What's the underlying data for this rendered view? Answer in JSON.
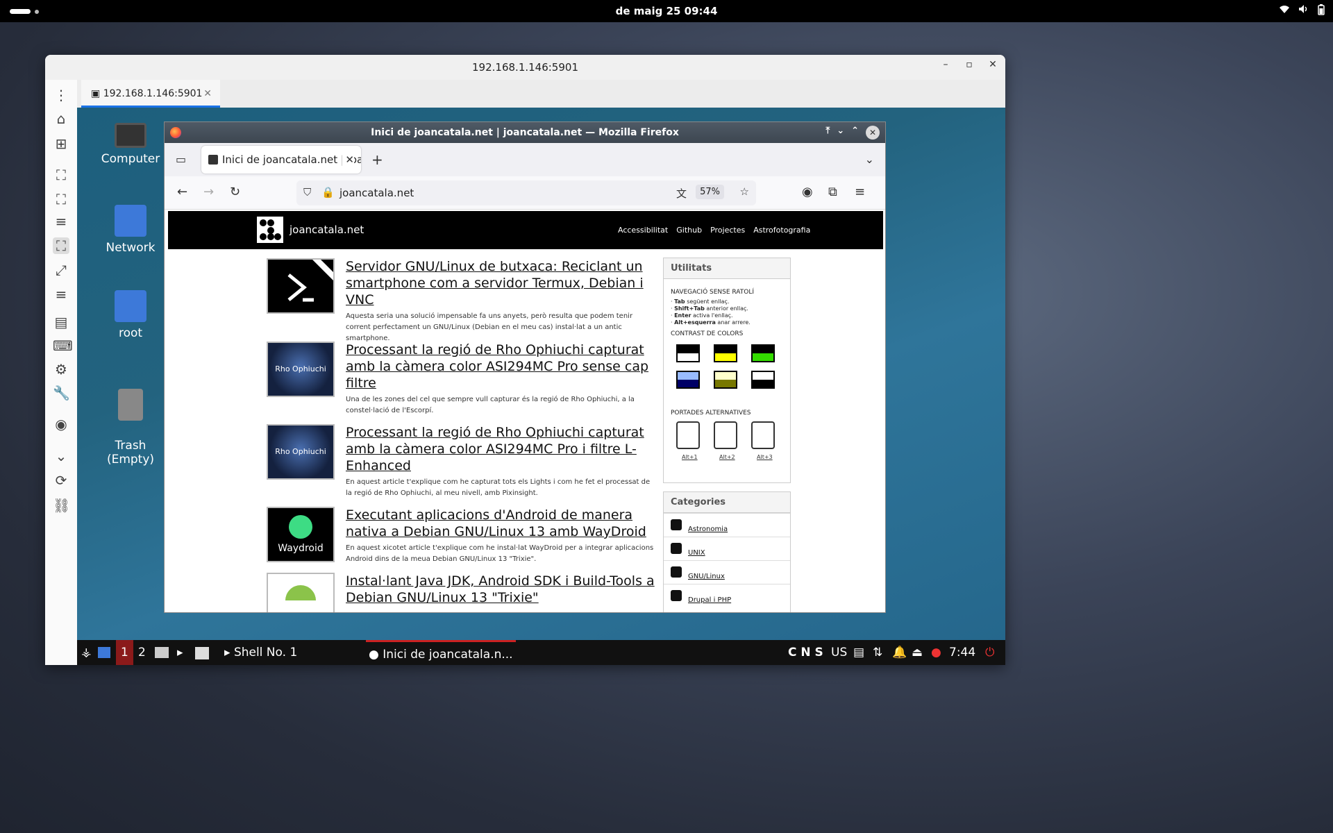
{
  "topbar": {
    "clock": "de maig 25  09:44",
    "tray_icons": [
      "wifi-icon",
      "volume-icon",
      "battery-icon"
    ]
  },
  "viewer": {
    "title": "192.168.1.146:5901",
    "tab_label": "192.168.1.146:5901",
    "controls": [
      "minimize",
      "maximize",
      "close"
    ]
  },
  "desktop": {
    "icons": [
      {
        "label": "Computer"
      },
      {
        "label": "Network"
      },
      {
        "label": "root"
      },
      {
        "label": "Trash\n(Empty)"
      }
    ]
  },
  "firefox": {
    "title": "Inici de joancatala.net | joancatala.net — Mozilla Firefox",
    "tab_label": "Inici de joancatala.net | joancatala.net",
    "url": "joancatala.net",
    "zoom": "57%"
  },
  "site": {
    "name": "joancatala.net",
    "nav": [
      "Accessibilitat",
      "Github",
      "Projectes",
      "Astrofotografia"
    ],
    "posts": [
      {
        "title": "Servidor GNU/Linux de butxaca: Reciclant un smartphone com a servidor Termux, Debian i VNC",
        "desc": "Aquesta seria una solució impensable fa uns anyets, però resulta que podem tenir corrent perfectament un GNU/Linux (Debian en el meu cas) instal·lat a un antic smartphone.",
        "thumb_label": ""
      },
      {
        "title": "Processant la regió de Rho Ophiuchi capturat amb la càmera color ASI294MC Pro sense cap filtre",
        "desc": "Una de les zones del cel que sempre vull capturar és la regió de Rho Ophiuchi, a la constel·lació de l'Escorpí.",
        "thumb_label": "Rho Ophiuchi"
      },
      {
        "title": "Processant la regió de Rho Ophiuchi capturat amb la càmera color ASI294MC Pro i filtre L-Enhanced",
        "desc": "En aquest article t'explique com he capturat tots els Lights i com he fet el processat de la regió de Rho Ophiuchi, al meu nivell, amb Pixinsight.",
        "thumb_label": "Rho Ophiuchi"
      },
      {
        "title": "Executant aplicacions d'Android de manera nativa a Debian GNU/Linux 13 amb WayDroid",
        "desc": "En aquest xicotet article t'explique com he instal·lat WayDroid per a integrar aplicacions Android dins de la meua Debian GNU/Linux 13 \"Trixie\".",
        "thumb_label": "Waydroid"
      },
      {
        "title": "Instal·lant Java JDK, Android SDK i Build-Tools a Debian GNU/Linux 13 \"Trixie\"",
        "desc": "",
        "thumb_label": ""
      }
    ],
    "utilitats": {
      "head": "Utilitats",
      "nav_head": "NAVEGACIÓ SENSE RATOLÍ",
      "nav_lines": [
        {
          "key": "Tab",
          "text": " següent enllaç."
        },
        {
          "key": "Shift+Tab",
          "text": " anterior enllaç."
        },
        {
          "key": "Enter",
          "text": " activa l'enllaç."
        },
        {
          "key": "Alt+esquerra",
          "text": " anar arrere."
        }
      ],
      "contrast_head": "CONTRAST DE COLORS",
      "swatches": [
        {
          "top": "#000000",
          "bottom": "#ffffff"
        },
        {
          "top": "#000000",
          "bottom": "#ffff00"
        },
        {
          "top": "#000000",
          "bottom": "#33dd00"
        },
        {
          "top": "#99bbff",
          "bottom": "#000066"
        },
        {
          "top": "#ffffcc",
          "bottom": "#777700"
        },
        {
          "top": "#ffffff",
          "bottom": "#000000"
        }
      ],
      "alt_head": "PORTADES ALTERNATIVES",
      "alt_labels": [
        "Alt+1",
        "Alt+2",
        "Alt+3"
      ]
    },
    "categories": {
      "head": "Categories",
      "items": [
        "Astronomia",
        "UNIX",
        "GNU/Linux",
        "Drupal i PHP"
      ]
    }
  },
  "xfce_panel": {
    "workspaces": [
      "1",
      "2"
    ],
    "tasks": [
      "Shell No. 1",
      "Inici de joancatala.n..."
    ],
    "indicators": "C N S",
    "layout": "US",
    "time": "7:44"
  }
}
